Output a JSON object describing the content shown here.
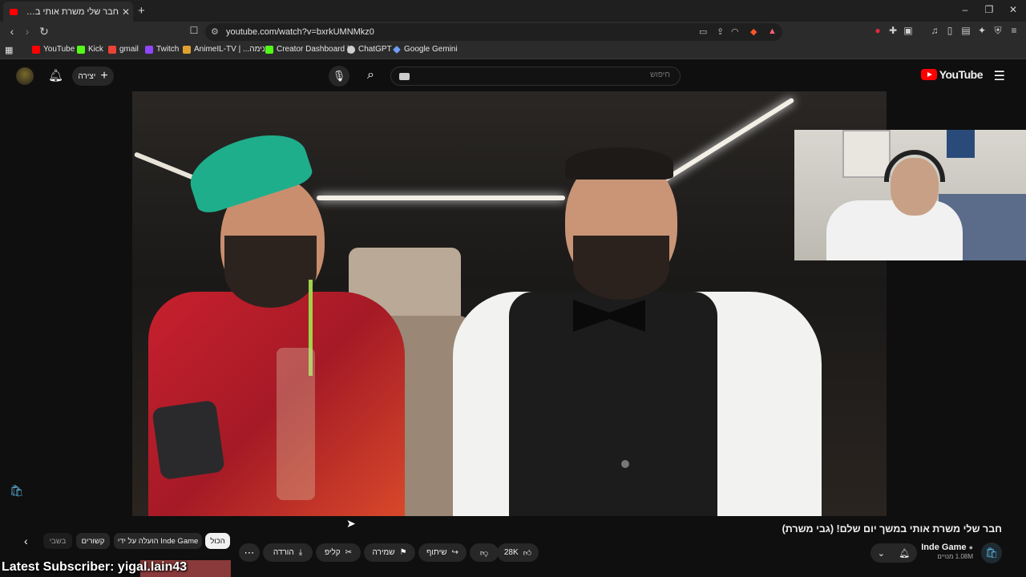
{
  "browser": {
    "tab_title": "חבר שלי משרת אותי במשך יום ש",
    "url": "youtube.com/watch?v=bxrkUMNMkz0",
    "bookmarks": [
      {
        "label": "YouTube",
        "color": "#ff0000"
      },
      {
        "label": "Kick",
        "color": "#53fc18"
      },
      {
        "label": "gmail",
        "color": "#ea4335"
      },
      {
        "label": "Twitch",
        "color": "#9146ff"
      },
      {
        "label": "AnimeIL-TV | ...אנימה",
        "color": "#e0a030"
      },
      {
        "label": "Creator Dashboard |...",
        "color": "#53fc18"
      },
      {
        "label": "ChatGPT",
        "color": "#cfcfcf"
      },
      {
        "label": "Google Gemini",
        "color": "#6f9cf5"
      }
    ]
  },
  "youtube": {
    "logo_text": "YouTube",
    "search_placeholder": "חיפוש",
    "create_label": "יצירה"
  },
  "video": {
    "title": "חבר שלי משרת אותי במשך יום שלם! (גבי משרת)",
    "channel_name": "Inde Game",
    "subscribers": "1.08M מנויים",
    "likes": "28K",
    "share_label": "שיתוף",
    "save_label": "שמירה",
    "clip_label": "קליפ",
    "download_label": "הורדה"
  },
  "chips": {
    "all": "הכול",
    "uploaded_by": "הועלה על ידי Inde Game",
    "related": "קשורים",
    "recent": "בשבי"
  },
  "overlay": {
    "latest_subscriber": "Latest Subscriber: yigal.lain43"
  }
}
